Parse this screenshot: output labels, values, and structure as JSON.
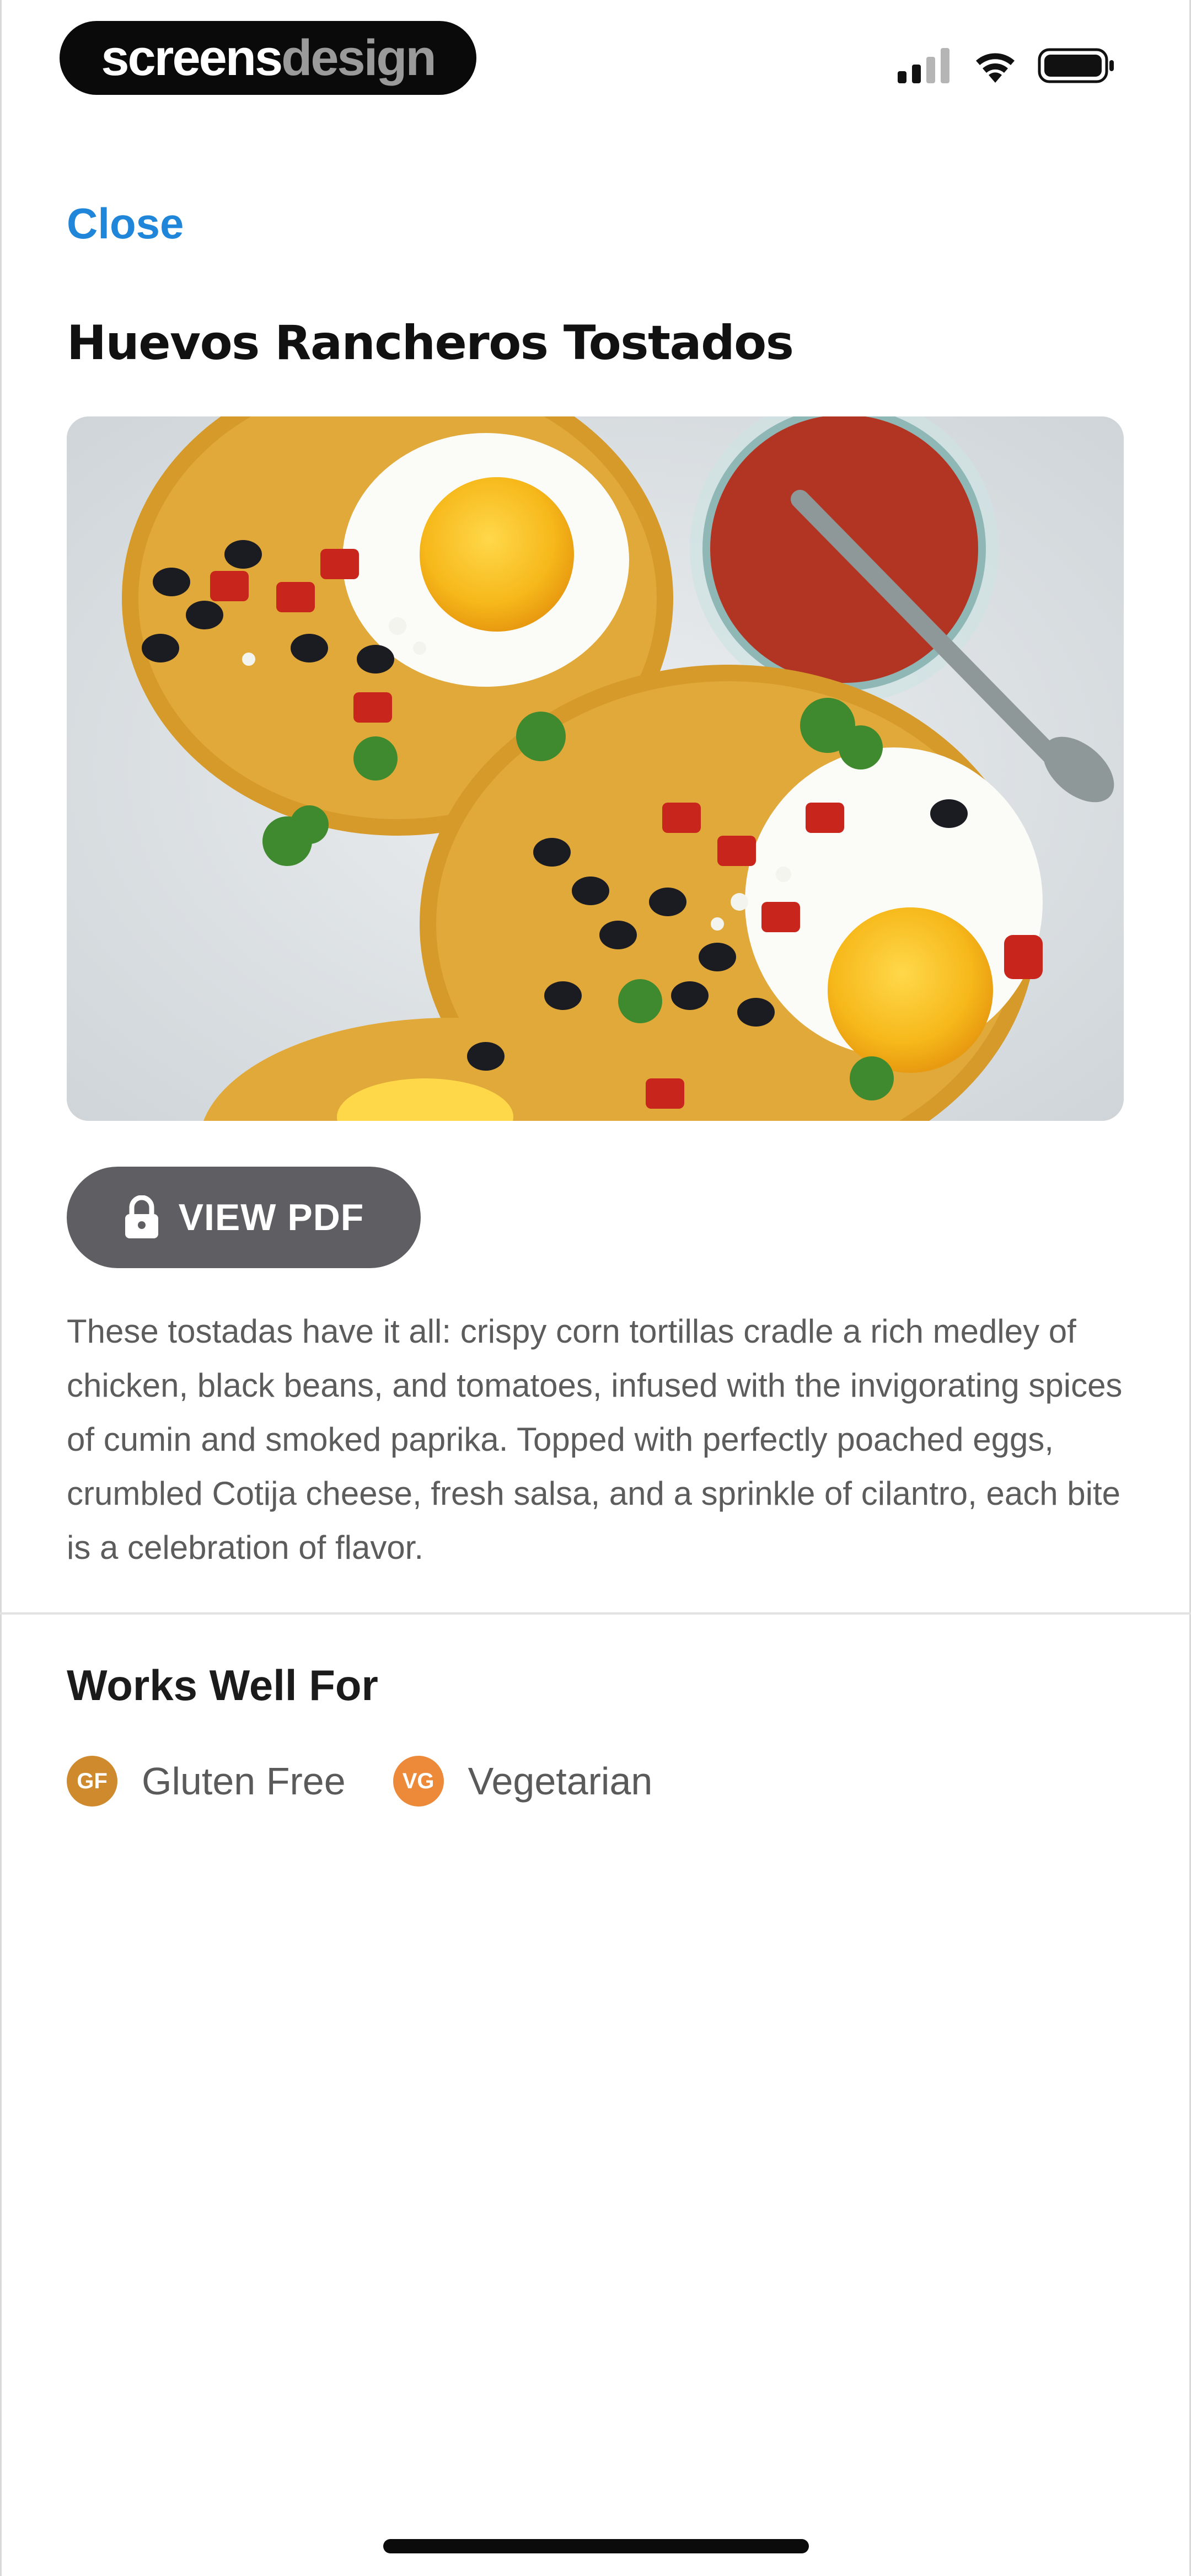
{
  "status_bar": {
    "brand_part1": "screens",
    "brand_part2": "design"
  },
  "header": {
    "close_label": "Close"
  },
  "recipe": {
    "title": "Huevos Rancheros Tostados",
    "image_alt": "Huevos rancheros tostadas topped with fried eggs, black beans, salsa and cilantro",
    "view_pdf_label": "VIEW PDF",
    "description": "These tostadas have it all: crispy corn tortillas cradle a rich medley of chicken, black beans, and tomatoes, infused with the invigorating spices of cumin and smoked paprika. Topped with perfectly poached eggs, crumbled Cotija cheese, fresh salsa, and a sprinkle of cilantro, each bite is a celebration of flavor."
  },
  "works_well_for": {
    "title": "Works Well For",
    "tags": [
      {
        "abbr": "GF",
        "label": "Gluten Free",
        "color": "#d08a2e"
      },
      {
        "abbr": "VG",
        "label": "Vegetarian",
        "color": "#ec8a3a"
      }
    ]
  },
  "colors": {
    "link": "#1f86d9",
    "button": "#5f5f63"
  }
}
